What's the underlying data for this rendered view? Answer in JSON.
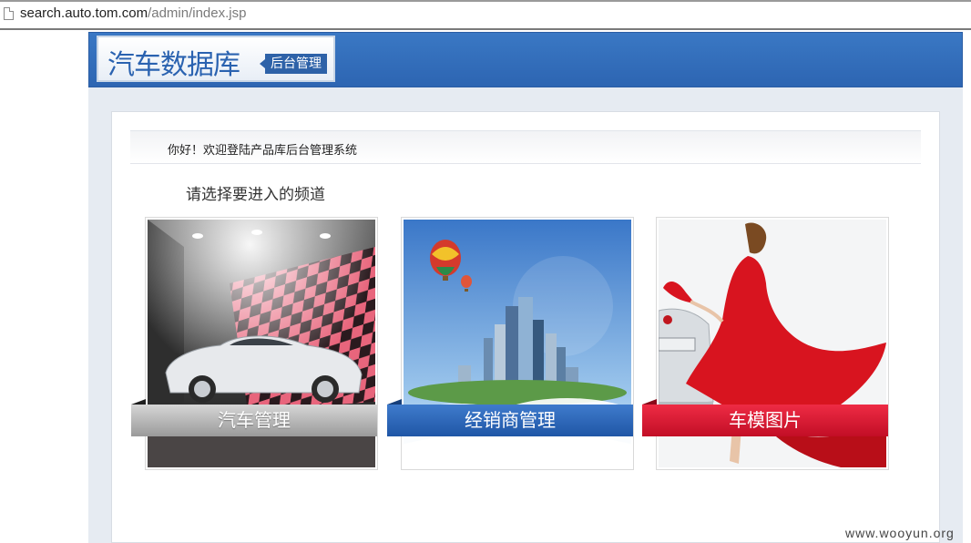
{
  "browser": {
    "url_host": "search.auto.tom.com",
    "url_path": "/admin/index.jsp"
  },
  "header": {
    "logo_title": "汽车数据库",
    "logo_tag": "后台管理"
  },
  "welcome": {
    "text": "你好！欢迎登陆产品库后台管理系统"
  },
  "prompt": "请选择要进入的频道",
  "channels": [
    {
      "label": "汽车管理",
      "icon": "car-photo"
    },
    {
      "label": "经销商管理",
      "icon": "city-skyline-photo"
    },
    {
      "label": "车模图片",
      "icon": "car-model-photo"
    }
  ],
  "watermark": "www.wooyun.org",
  "colors": {
    "header_blue": "#2d65b2",
    "channel_grey": "#9a9a9a",
    "channel_blue": "#1f56a6",
    "channel_red": "#c20e26"
  }
}
